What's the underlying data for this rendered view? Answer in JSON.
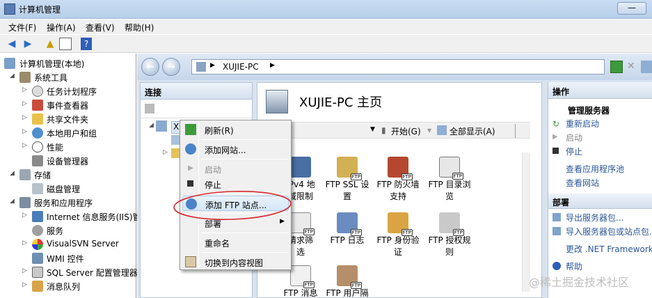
{
  "window": {
    "title": "计算机管理"
  },
  "menu": [
    "文件(F)",
    "操作(A)",
    "查看(V)",
    "帮助(H)"
  ],
  "tree": [
    {
      "label": "计算机管理(本地)",
      "level": 0
    },
    {
      "label": "系统工具",
      "level": 1
    },
    {
      "label": "任务计划程序",
      "level": 2
    },
    {
      "label": "事件查看器",
      "level": 2
    },
    {
      "label": "共享文件夹",
      "level": 2
    },
    {
      "label": "本地用户和组",
      "level": 2
    },
    {
      "label": "性能",
      "level": 2
    },
    {
      "label": "设备管理器",
      "level": 2
    },
    {
      "label": "存储",
      "level": 1
    },
    {
      "label": "磁盘管理",
      "level": 2
    },
    {
      "label": "服务和应用程序",
      "level": 1
    },
    {
      "label": "Internet 信息服务(IIS)管",
      "level": 2
    },
    {
      "label": "服务",
      "level": 2
    },
    {
      "label": "VisualSVN Server",
      "level": 2
    },
    {
      "label": "WMI 控件",
      "level": 2
    },
    {
      "label": "SQL Server 配置管理器",
      "level": 2
    },
    {
      "label": "消息队列",
      "level": 2
    }
  ],
  "address": {
    "segment": "XUJIE-PC"
  },
  "connections": {
    "title": "连接",
    "server_node": "XU"
  },
  "home": {
    "title": "XUJIE-PC 主页",
    "start_label": "开始(G)",
    "showall_label": "全部显示(A)",
    "features": [
      {
        "label": "IPv4 地\n域限制",
        "badge": ""
      },
      {
        "label": "FTP SSL 设\n置",
        "badge": "FTP"
      },
      {
        "label": "FTP 防火墙\n支持",
        "badge": "FTP"
      },
      {
        "label": "FTP 目录浏\n览",
        "badge": "FTP"
      },
      {
        "label": "请求筛\n选",
        "badge": "FTP"
      },
      {
        "label": "FTP 日志",
        "badge": "FTP"
      },
      {
        "label": "FTP 身份验\n证",
        "badge": "FTP"
      },
      {
        "label": "FTP 授权规\n则",
        "badge": "FTP"
      },
      {
        "label": "FTP 消息",
        "badge": "FTP"
      },
      {
        "label": "FTP 用户隔",
        "badge": "FTP"
      }
    ]
  },
  "actions": {
    "title": "操作",
    "manage_server": "管理服务器",
    "restart": "重新启动",
    "start": "启动",
    "stop": "停止",
    "view_pools": "查看应用程序池",
    "view_sites": "查看网站",
    "deploy_title": "部署",
    "export": "导出服务器包...",
    "import": "导入服务器包或站点包...",
    "change_net": "更改 .NET Framework",
    "help": "帮助"
  },
  "context_menu": {
    "refresh": "刷新(R)",
    "add_site": "添加网站...",
    "start": "启动",
    "stop": "停止",
    "add_ftp": "添加 FTP 站点...",
    "deploy": "部署",
    "rename": "重命名",
    "switch_view": "切换到内容视图"
  },
  "watermark": "@稀土掘金技术社区",
  "colors": {
    "highlight_circle": "#d8282f",
    "accent": "#2b5797"
  }
}
